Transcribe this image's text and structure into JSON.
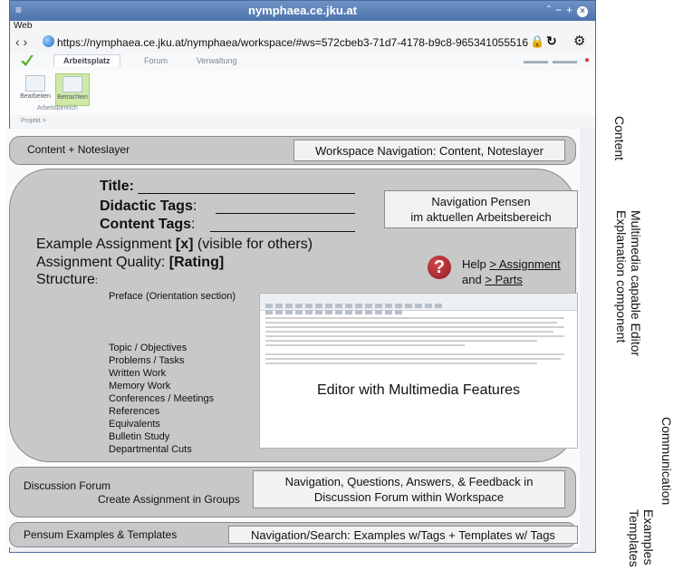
{
  "browser": {
    "title": "nymphaea.ce.jku.at",
    "menu": "Web",
    "url": "https://nymphaea.ce.jku.at/nymphaea/workspace/#ws=572cbeb3-71d7-4178-b9c8-965341055516"
  },
  "app": {
    "tabs": [
      "Arbeitsplatz",
      "Forum",
      "Verwaltung"
    ],
    "ribbon_buttons": [
      "Bearbeiten",
      "Betrachten"
    ],
    "ribbon_group": "Arbeitsbereich",
    "breadcrumb": "Projekt >"
  },
  "content_panel": {
    "label": "Content + Noteslayer",
    "nav": "Workspace Navigation: Content, Noteslayer"
  },
  "editor_panel": {
    "title_label": "Title:",
    "didactic_label": "Didactic Tags",
    "didactic_colon": ":",
    "content_tags_label": "Content Tags",
    "content_tags_colon": ":",
    "example_prefix": "Example Assignment ",
    "example_bold": "[x]",
    "example_suffix": " (visible for others)",
    "quality_prefix": "Assignment Quality: ",
    "quality_bold": "[Rating]",
    "structure_label": "Structure",
    "structure_colon": ":",
    "nav_line1": "Navigation Pensen",
    "nav_line2": "im aktuellen Arbeitsbereich",
    "help_prefix": "Help ",
    "help_link1": "> Assignment",
    "help_and": "and ",
    "help_link2": "> Parts",
    "preface": "Preface (Orientation section)",
    "structure_items": [
      "Topic / Objectives",
      "Problems / Tasks",
      "Written Work",
      "Memory Work",
      "Conferences / Meetings",
      "References",
      "Equivalents",
      "Bulletin Study",
      "Departmental Cuts"
    ],
    "editor_caption": "Editor with Multimedia Features"
  },
  "discussion_panel": {
    "label": "Discussion Forum",
    "sublabel": "Create Assignment in Groups",
    "nav_line1": "Navigation, Questions, Answers, & Feedback in",
    "nav_line2": "Discussion Forum within Workspace"
  },
  "examples_panel": {
    "label": "Pensum Examples & Templates",
    "nav": "Navigation/Search: Examples w/Tags + Templates w/ Tags"
  },
  "side_labels": {
    "content": "Content",
    "multimedia_1": "Multimedia capable Editor",
    "multimedia_2": "Explanation component",
    "communication": "Communication",
    "examples_1": "Examples",
    "examples_2": "Templates"
  }
}
